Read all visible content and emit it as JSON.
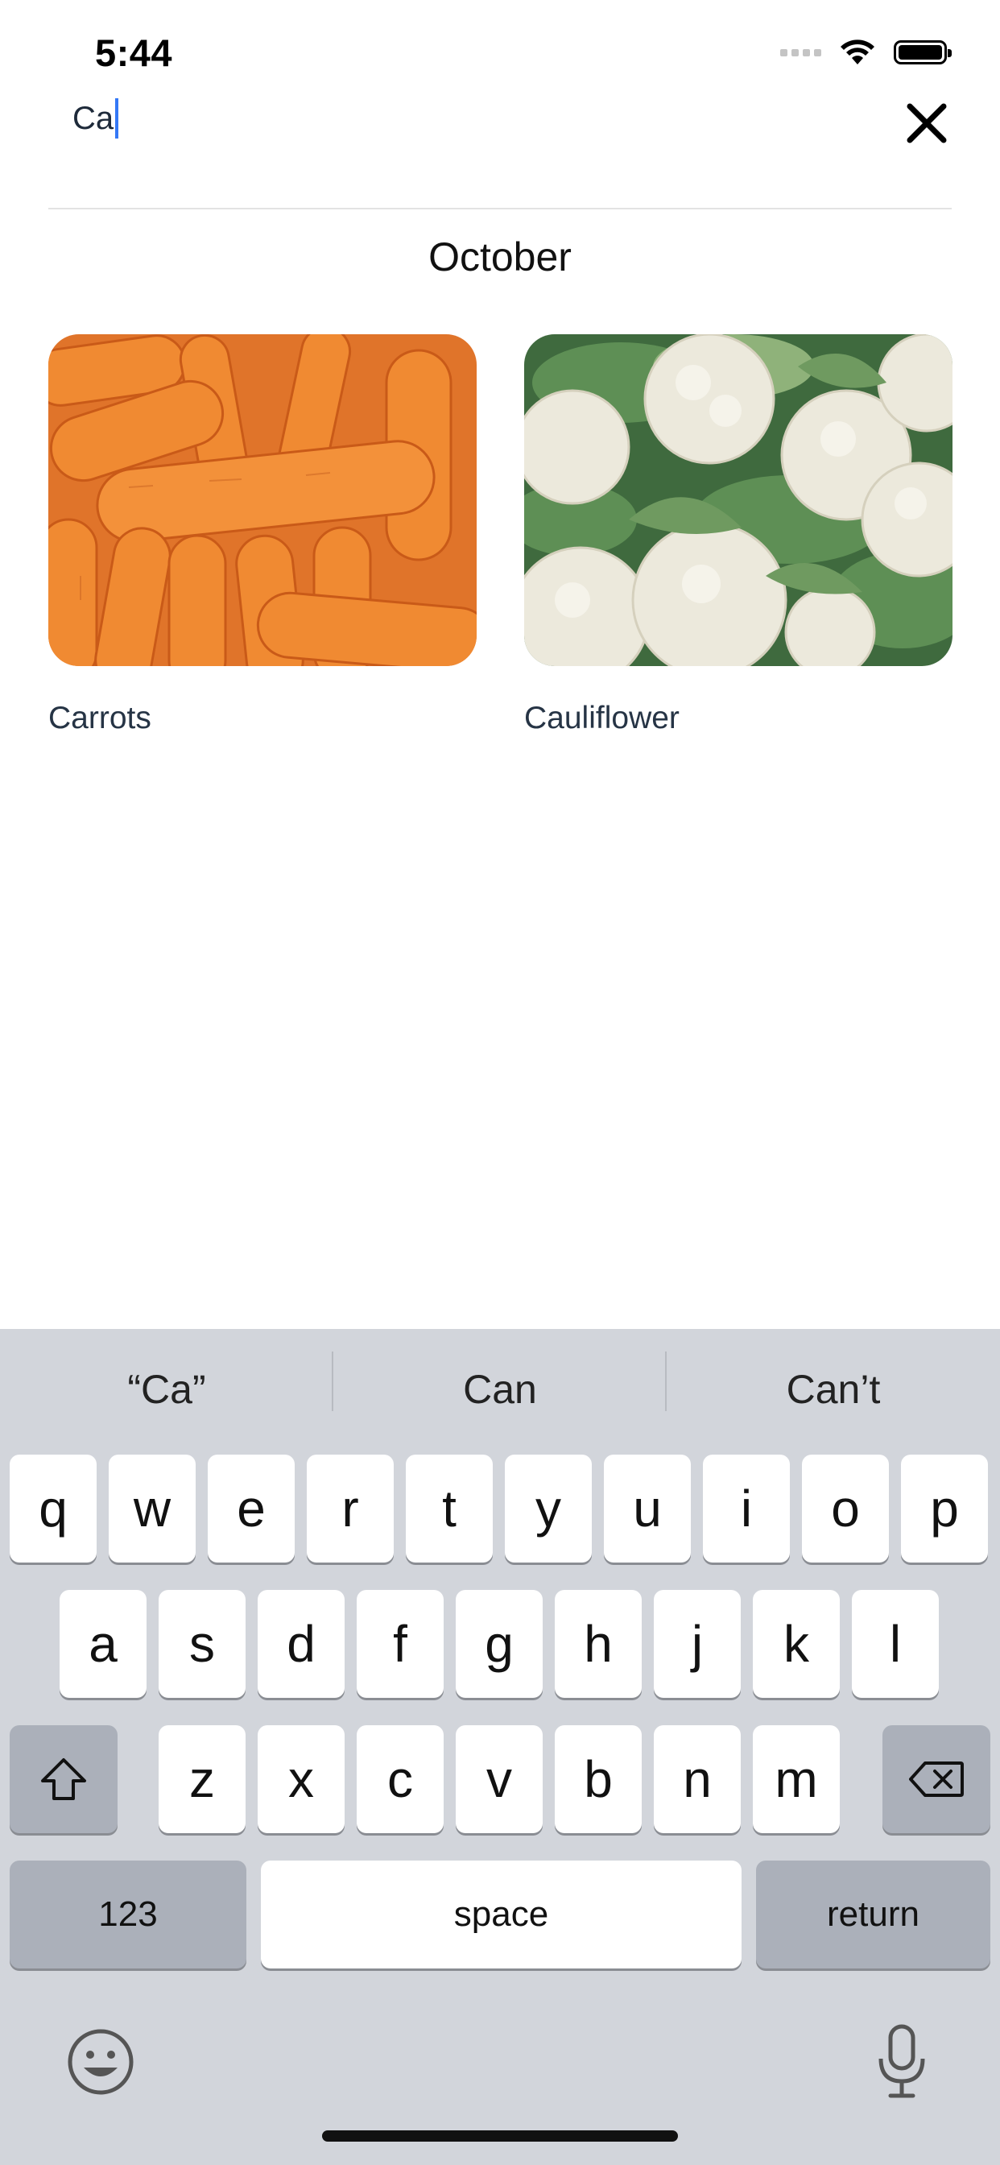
{
  "status_bar": {
    "time": "5:44"
  },
  "search": {
    "value": "Ca"
  },
  "section": {
    "title": "October"
  },
  "results": [
    {
      "label": "Carrots",
      "image": "carrots-photo"
    },
    {
      "label": "Cauliflower",
      "image": "cauliflower-photo"
    }
  ],
  "keyboard": {
    "suggestions": [
      "“Ca”",
      "Can",
      "Can’t"
    ],
    "row1": [
      "q",
      "w",
      "e",
      "r",
      "t",
      "y",
      "u",
      "i",
      "o",
      "p"
    ],
    "row2": [
      "a",
      "s",
      "d",
      "f",
      "g",
      "h",
      "j",
      "k",
      "l"
    ],
    "row3": [
      "z",
      "x",
      "c",
      "v",
      "b",
      "n",
      "m"
    ],
    "numbers_label": "123",
    "space_label": "space",
    "return_label": "return"
  },
  "colors": {
    "caret": "#3478f6",
    "keyboard_bg": "#d2d5db",
    "label_text": "#263445"
  }
}
